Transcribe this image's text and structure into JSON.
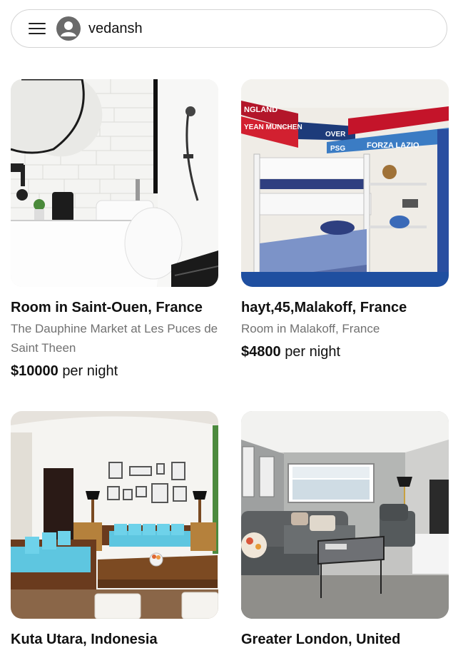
{
  "header": {
    "username": "vedansh"
  },
  "listings": [
    {
      "title": "Room in Saint-Ouen, France",
      "subtitle": "The Dauphine Market at Les Puces de Saint Theen",
      "price": "$10000",
      "price_suffix": "per night"
    },
    {
      "title": "hayt,45,Malakoff, France",
      "subtitle": "Room in Malakoff, France",
      "price": "$4800",
      "price_suffix": "per night"
    },
    {
      "title": "Kuta Utara, Indonesia",
      "subtitle": "",
      "price": "",
      "price_suffix": ""
    },
    {
      "title": "Greater London, United",
      "subtitle": "",
      "price": "",
      "price_suffix": ""
    }
  ],
  "photo_labels": {
    "scarf_1": "NGLAND",
    "scarf_2": "YEAN MUNCHEN",
    "scarf_3": "FORZA LAZIO",
    "scarf_4": "PSG",
    "scarf_5": "OVER"
  },
  "colors": {
    "accent_text": "#111111",
    "muted_text": "#717171",
    "border": "#d4d4d4"
  }
}
